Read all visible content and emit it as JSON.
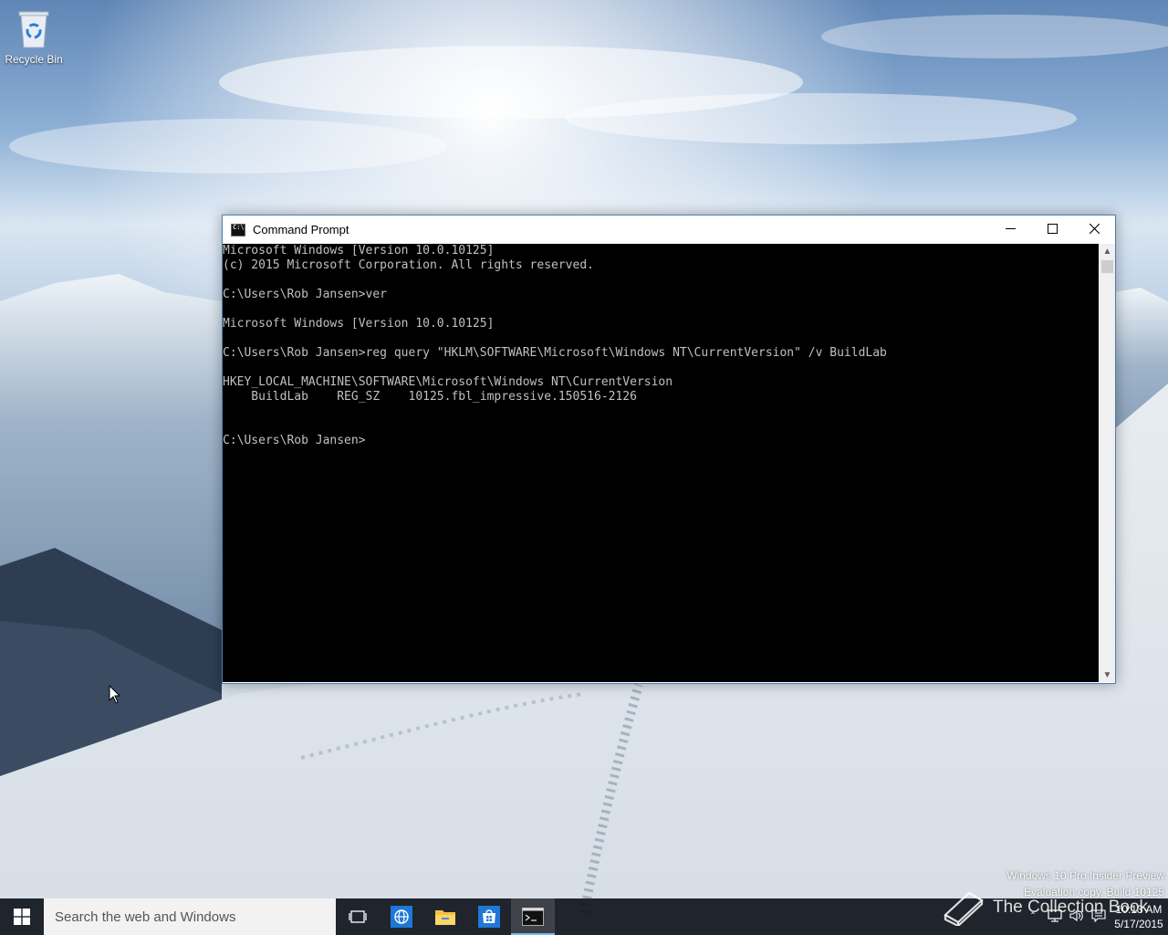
{
  "desktop": {
    "recycle_bin_label": "Recycle Bin"
  },
  "window": {
    "title": "Command Prompt",
    "console_lines": [
      "Microsoft Windows [Version 10.0.10125]",
      "(c) 2015 Microsoft Corporation. All rights reserved.",
      "",
      "C:\\Users\\Rob Jansen>ver",
      "",
      "Microsoft Windows [Version 10.0.10125]",
      "",
      "C:\\Users\\Rob Jansen>reg query \"HKLM\\SOFTWARE\\Microsoft\\Windows NT\\CurrentVersion\" /v BuildLab",
      "",
      "HKEY_LOCAL_MACHINE\\SOFTWARE\\Microsoft\\Windows NT\\CurrentVersion",
      "    BuildLab    REG_SZ    10125.fbl_impressive.150516-2126",
      "",
      "",
      "C:\\Users\\Rob Jansen>"
    ],
    "colors": {
      "console_bg": "#000000",
      "console_fg": "#c0c0c0"
    }
  },
  "watermark": {
    "line1": "Windows 10 Pro Insider Preview",
    "line2": "Evaluation copy. Build 10125",
    "collection_text": "The Collection Book"
  },
  "taskbar": {
    "search_placeholder": "Search the web and Windows",
    "pinned": [
      {
        "name": "task-view-icon"
      },
      {
        "name": "browser-icon"
      },
      {
        "name": "file-explorer-icon"
      },
      {
        "name": "store-icon"
      },
      {
        "name": "command-prompt-icon",
        "active": true
      }
    ],
    "clock_time": "10:13 AM",
    "clock_date": "5/17/2015",
    "accent": "#76b9ed"
  }
}
